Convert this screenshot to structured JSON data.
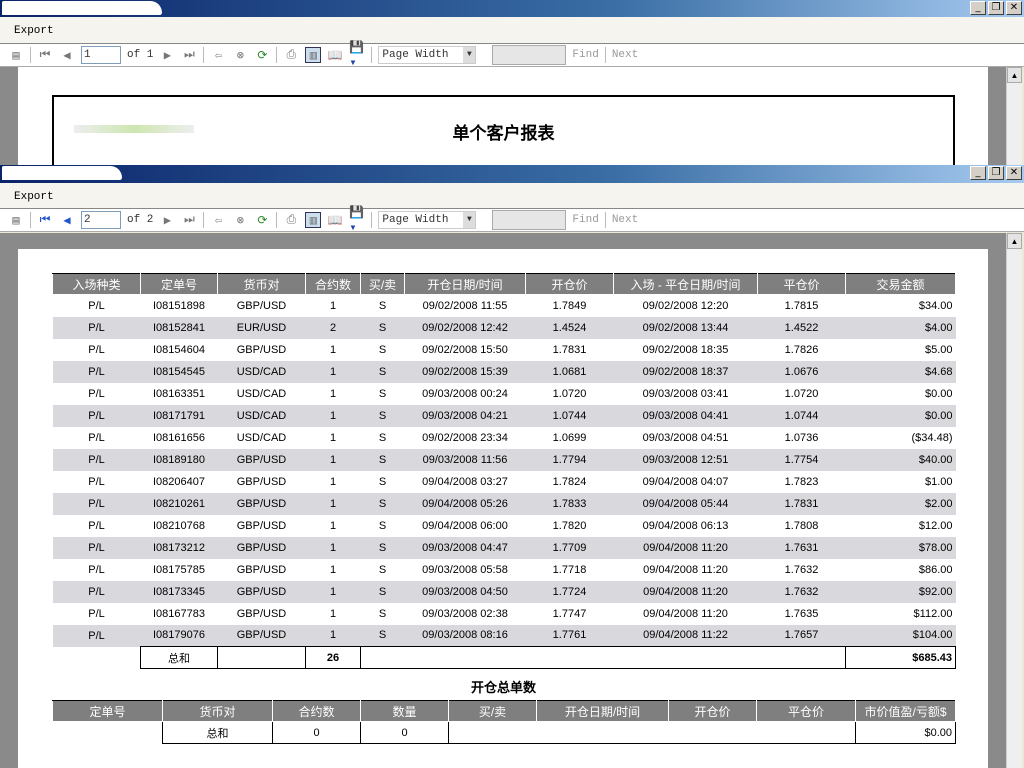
{
  "window1": {
    "menu": "Export",
    "page": "1",
    "of": "of 1",
    "zoom": "Page Width",
    "find": "Find",
    "next": "Next",
    "report_title": "单个客户报表"
  },
  "window2": {
    "menu": "Export",
    "page": "2",
    "of": "of 2",
    "zoom": "Page Width",
    "find": "Find",
    "next": "Next"
  },
  "table1": {
    "headers": [
      "入场种类",
      "定单号",
      "货币对",
      "合约数",
      "买/卖",
      "开仓日期/时间",
      "开仓价",
      "入场 - 平仓日期/时间",
      "平仓价",
      "交易金额"
    ],
    "rows": [
      [
        "P/L",
        "I08151898",
        "GBP/USD",
        "1",
        "S",
        "09/02/2008 11:55",
        "1.7849",
        "09/02/2008 12:20",
        "1.7815",
        "$34.00"
      ],
      [
        "P/L",
        "I08152841",
        "EUR/USD",
        "2",
        "S",
        "09/02/2008 12:42",
        "1.4524",
        "09/02/2008 13:44",
        "1.4522",
        "$4.00"
      ],
      [
        "P/L",
        "I08154604",
        "GBP/USD",
        "1",
        "S",
        "09/02/2008 15:50",
        "1.7831",
        "09/02/2008 18:35",
        "1.7826",
        "$5.00"
      ],
      [
        "P/L",
        "I08154545",
        "USD/CAD",
        "1",
        "S",
        "09/02/2008 15:39",
        "1.0681",
        "09/02/2008 18:37",
        "1.0676",
        "$4.68"
      ],
      [
        "P/L",
        "I08163351",
        "USD/CAD",
        "1",
        "S",
        "09/03/2008 00:24",
        "1.0720",
        "09/03/2008 03:41",
        "1.0720",
        "$0.00"
      ],
      [
        "P/L",
        "I08171791",
        "USD/CAD",
        "1",
        "S",
        "09/03/2008 04:21",
        "1.0744",
        "09/03/2008 04:41",
        "1.0744",
        "$0.00"
      ],
      [
        "P/L",
        "I08161656",
        "USD/CAD",
        "1",
        "S",
        "09/02/2008 23:34",
        "1.0699",
        "09/03/2008 04:51",
        "1.0736",
        "($34.48)"
      ],
      [
        "P/L",
        "I08189180",
        "GBP/USD",
        "1",
        "S",
        "09/03/2008 11:56",
        "1.7794",
        "09/03/2008 12:51",
        "1.7754",
        "$40.00"
      ],
      [
        "P/L",
        "I08206407",
        "GBP/USD",
        "1",
        "S",
        "09/04/2008 03:27",
        "1.7824",
        "09/04/2008 04:07",
        "1.7823",
        "$1.00"
      ],
      [
        "P/L",
        "I08210261",
        "GBP/USD",
        "1",
        "S",
        "09/04/2008 05:26",
        "1.7833",
        "09/04/2008 05:44",
        "1.7831",
        "$2.00"
      ],
      [
        "P/L",
        "I08210768",
        "GBP/USD",
        "1",
        "S",
        "09/04/2008 06:00",
        "1.7820",
        "09/04/2008 06:13",
        "1.7808",
        "$12.00"
      ],
      [
        "P/L",
        "I08173212",
        "GBP/USD",
        "1",
        "S",
        "09/03/2008 04:47",
        "1.7709",
        "09/04/2008 11:20",
        "1.7631",
        "$78.00"
      ],
      [
        "P/L",
        "I08175785",
        "GBP/USD",
        "1",
        "S",
        "09/03/2008 05:58",
        "1.7718",
        "09/04/2008 11:20",
        "1.7632",
        "$86.00"
      ],
      [
        "P/L",
        "I08173345",
        "GBP/USD",
        "1",
        "S",
        "09/03/2008 04:50",
        "1.7724",
        "09/04/2008 11:20",
        "1.7632",
        "$92.00"
      ],
      [
        "P/L",
        "I08167783",
        "GBP/USD",
        "1",
        "S",
        "09/03/2008 02:38",
        "1.7747",
        "09/04/2008 11:20",
        "1.7635",
        "$112.00"
      ],
      [
        "P/L",
        "I08179076",
        "GBP/USD",
        "1",
        "S",
        "09/03/2008 08:16",
        "1.7761",
        "09/04/2008 11:22",
        "1.7657",
        "$104.00"
      ]
    ],
    "total_label": "总和",
    "total_contracts": "26",
    "total_amount": "$685.43"
  },
  "section2_title": "开仓总单数",
  "table2": {
    "headers": [
      "定单号",
      "货币对",
      "合约数",
      "数量",
      "买/卖",
      "开仓日期/时间",
      "开仓价",
      "平仓价",
      "市价值盈/亏额$"
    ],
    "total_label": "总和",
    "total_contracts": "0",
    "total_qty": "0",
    "total_amount": "$0.00"
  }
}
